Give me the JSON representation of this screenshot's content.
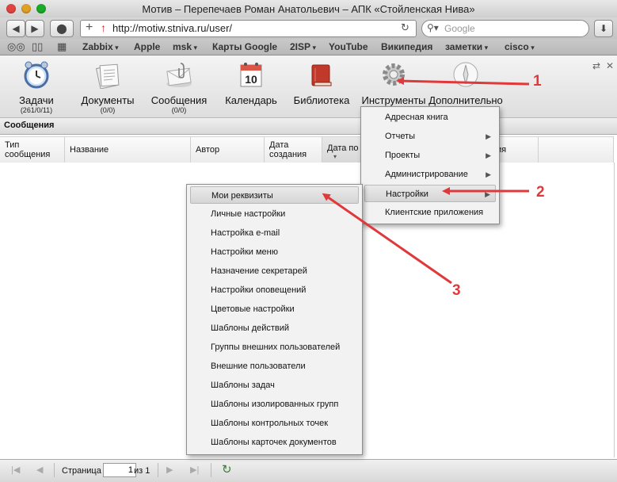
{
  "window": {
    "title": "Мотив – Перепечаев Роман Анатольевич – АПК «Стойленская Нива»",
    "url": "http://motiw.stniva.ru/user/",
    "search_placeholder": "Google"
  },
  "bookmarks": [
    {
      "label": "Zabbix",
      "dropdown": true
    },
    {
      "label": "Apple",
      "dropdown": false
    },
    {
      "label": "msk",
      "dropdown": true
    },
    {
      "label": "Карты Google",
      "dropdown": false
    },
    {
      "label": "2ISP",
      "dropdown": true
    },
    {
      "label": "YouTube",
      "dropdown": false
    },
    {
      "label": "Википедия",
      "dropdown": false
    },
    {
      "label": "заметки",
      "dropdown": true
    },
    {
      "label": "cisco",
      "dropdown": true
    }
  ],
  "app_toolbar": [
    {
      "label": "Задачи",
      "count": "(261/0/11)",
      "icon": "clock-icon"
    },
    {
      "label": "Документы",
      "count": "(0/0)",
      "icon": "documents-icon"
    },
    {
      "label": "Сообщения",
      "count": "(0/0)",
      "icon": "messages-icon"
    },
    {
      "label": "Календарь",
      "count": "",
      "icon": "calendar-icon",
      "calendar_day": "10"
    },
    {
      "label": "Библиотека",
      "count": "",
      "icon": "library-icon"
    },
    {
      "label": "Инструменты",
      "count": "",
      "icon": "gear-icon"
    },
    {
      "label": "Дополнительно",
      "count": "",
      "icon": "compass-icon"
    }
  ],
  "section_title": "Сообщения",
  "grid": {
    "columns": [
      "Тип сообщения",
      "Название",
      "Автор",
      "Дата создания",
      "Дата по",
      "ия"
    ]
  },
  "tools_menu": [
    {
      "label": "Адресная книга",
      "submenu": false
    },
    {
      "label": "Отчеты",
      "submenu": true
    },
    {
      "label": "Проекты",
      "submenu": true
    },
    {
      "label": "Администрирование",
      "submenu": true
    },
    {
      "label": "Настройки",
      "submenu": true,
      "highlighted": true
    },
    {
      "label": "Клиентские приложения",
      "submenu": false
    }
  ],
  "settings_menu": [
    {
      "label": "Мои реквизиты",
      "highlighted": true
    },
    {
      "label": "Личные настройки"
    },
    {
      "label": "Настройка e-mail"
    },
    {
      "label": "Настройки меню"
    },
    {
      "label": "Назначение секретарей"
    },
    {
      "label": "Настройки оповещений"
    },
    {
      "label": "Цветовые настройки"
    },
    {
      "label": "Шаблоны действий"
    },
    {
      "label": "Группы внешних пользователей"
    },
    {
      "label": "Внешние пользователи"
    },
    {
      "label": "Шаблоны задач"
    },
    {
      "label": "Шаблоны изолированных групп"
    },
    {
      "label": "Шаблоны контрольных точек"
    },
    {
      "label": "Шаблоны карточек документов"
    }
  ],
  "pager": {
    "page_label": "Страница",
    "page_value": "1",
    "of_label": "из 1"
  },
  "annotations": [
    "1",
    "2",
    "3"
  ],
  "colors": {
    "annotation": "#e0393b",
    "highlight": "#d9d9d9"
  }
}
